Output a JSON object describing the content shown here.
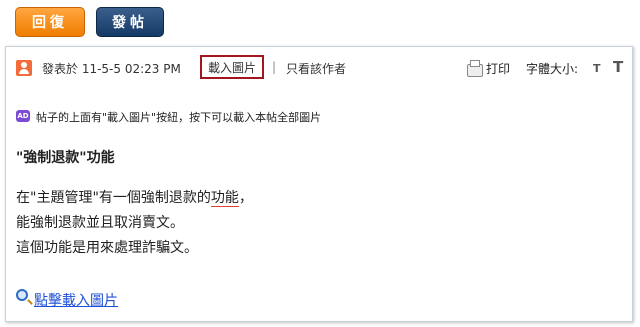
{
  "toolbar": {
    "reply_label": "回復",
    "post_label": "發帖"
  },
  "post_meta": {
    "posted_at": "發表於 11-5-5 02:23 PM",
    "load_images": "載入圖片",
    "separator": "|",
    "only_author": "只看該作者",
    "print": "打印",
    "font_size": "字體大小:",
    "font_small": "T",
    "font_large": "T"
  },
  "tip": {
    "icon": "AD",
    "text": "帖子的上面有\"載入圖片\"按紐，按下可以載入本帖全部圖片"
  },
  "post": {
    "heading": "\"強制退款\"功能",
    "line1_before": "在\"主題管理\"有一個強制退款的",
    "line1_underlined": "功能",
    "line1_after": "，",
    "line2": "能強制退款並且取消賣文。",
    "line3": "這個功能是用來處理詐騙文。"
  },
  "link": {
    "label": "點擊載入圖片"
  },
  "colors": {
    "reply_button": "#f58b12",
    "post_button": "#1f4470",
    "highlight_border": "#a2171f",
    "link": "#1f4fd8"
  }
}
